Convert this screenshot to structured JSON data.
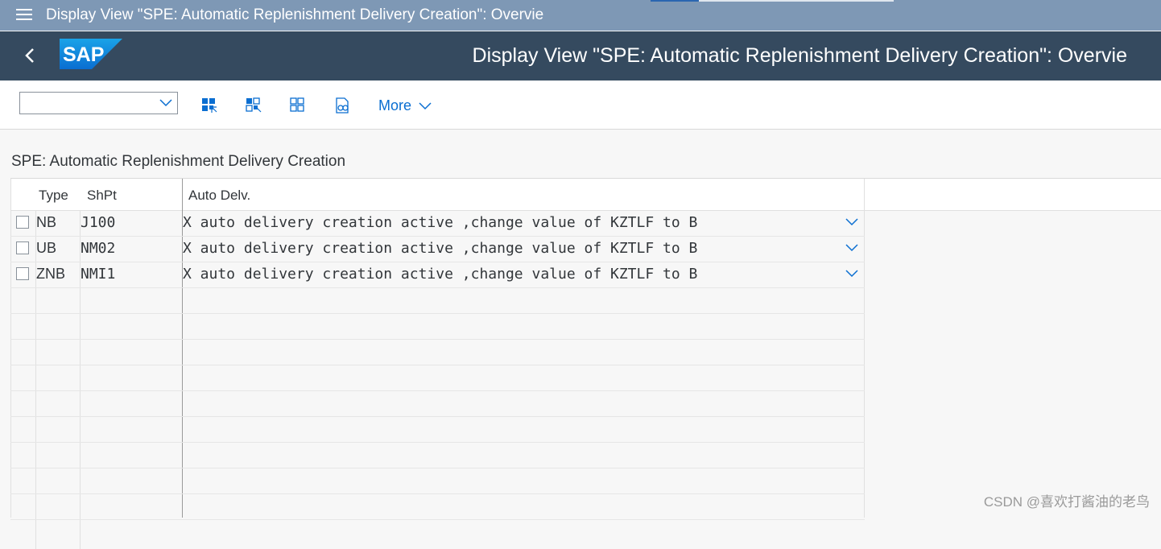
{
  "window": {
    "title": "Display View \"SPE: Automatic Replenishment Delivery Creation\": Overvie"
  },
  "shell": {
    "title": "Display View \"SPE: Automatic Replenishment Delivery Creation\": Overvie",
    "logo_text": "SAP"
  },
  "toolbar": {
    "select_value": "",
    "more_label": "More"
  },
  "section": {
    "title": "SPE: Automatic Replenishment Delivery Creation"
  },
  "table": {
    "headers": [
      "Type",
      "ShPt",
      "Auto Delv."
    ],
    "rows": [
      {
        "type": "NB",
        "shpt": "J100",
        "auto": "X auto delivery creation active ,change value of KZTLF to B"
      },
      {
        "type": "UB",
        "shpt": "NM02",
        "auto": "X auto delivery creation active ,change value of KZTLF to B"
      },
      {
        "type": "ZNB",
        "shpt": "NMI1",
        "auto": "X auto delivery creation active ,change value of KZTLF to B"
      }
    ]
  },
  "watermark": "CSDN @喜欢打酱油的老鸟",
  "colors": {
    "titlebar": "#7e98b5",
    "shellbar": "#354a5f",
    "accent": "#0a6ed1"
  }
}
